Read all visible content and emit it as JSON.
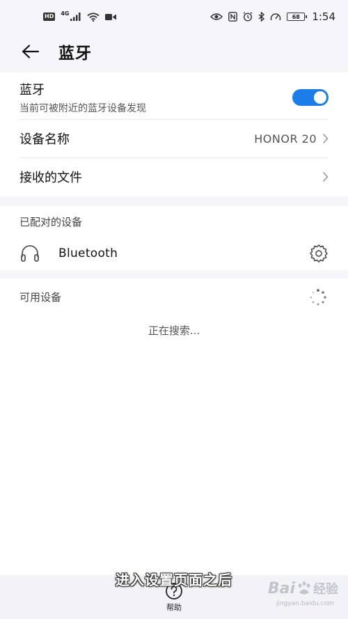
{
  "status_bar": {
    "hd": "HD",
    "network": "4G",
    "battery": "68",
    "time": "1:54"
  },
  "header": {
    "title": "蓝牙"
  },
  "bluetooth": {
    "label": "蓝牙",
    "subtitle": "当前可被附近的蓝牙设备发现",
    "enabled": true,
    "accent_color": "#1a7dea"
  },
  "device_name": {
    "label": "设备名称",
    "value": "HONOR 20"
  },
  "received_files": {
    "label": "接收的文件"
  },
  "paired_section": {
    "title": "已配对的设备",
    "devices": [
      {
        "name": "Bluetooth",
        "icon": "headset-icon"
      }
    ]
  },
  "available_section": {
    "title": "可用设备",
    "status": "正在搜索..."
  },
  "bottom_bar": {
    "help_label": "帮助"
  },
  "caption": "进入设置页面之后",
  "watermark": {
    "brand": "Bai",
    "brand_cn": "经验",
    "url": "jingyan.baidu.com"
  }
}
